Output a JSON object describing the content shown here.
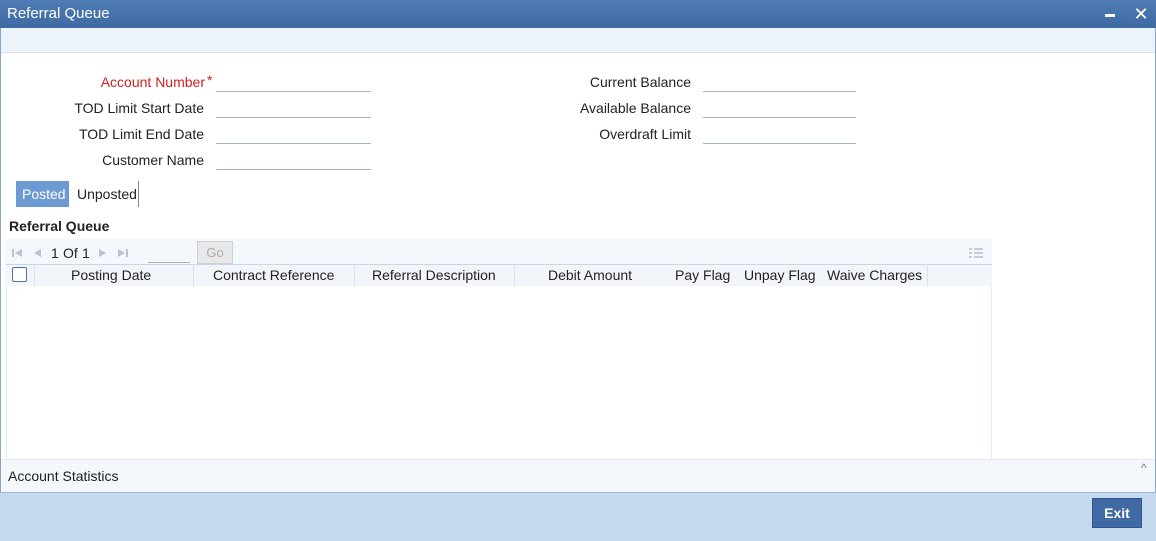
{
  "window": {
    "title": "Referral Queue"
  },
  "form": {
    "account_number_label": "Account Number",
    "required_marker": "*",
    "tod_start_label": "TOD Limit Start Date",
    "tod_end_label": "TOD Limit End Date",
    "customer_name_label": "Customer Name",
    "current_balance_label": "Current Balance",
    "available_balance_label": "Available Balance",
    "overdraft_limit_label": "Overdraft Limit",
    "account_number": "",
    "tod_start": "",
    "tod_end": "",
    "customer_name": "",
    "current_balance": "",
    "available_balance": "",
    "overdraft_limit": ""
  },
  "tabs": [
    {
      "label": "Posted",
      "active": true
    },
    {
      "label": "Unposted",
      "active": false
    }
  ],
  "queue": {
    "title": "Referral Queue",
    "pagination": {
      "current": "1",
      "of_label": "Of",
      "total": "1",
      "go_label": "Go",
      "page_input": ""
    },
    "columns": [
      "Posting Date",
      "Contract Reference",
      "Referral Description",
      "Debit Amount",
      "Pay Flag",
      "Unpay Flag",
      "Waive Charges"
    ],
    "rows": []
  },
  "stats": {
    "label": "Account Statistics"
  },
  "footer": {
    "exit_label": "Exit"
  },
  "colors": {
    "title_bar": "#4f7cb4",
    "active_tab": "#6e9ad3",
    "required": "#d21f1f",
    "footer": "#c5d9ef",
    "exit_button": "#3f6aa3"
  }
}
